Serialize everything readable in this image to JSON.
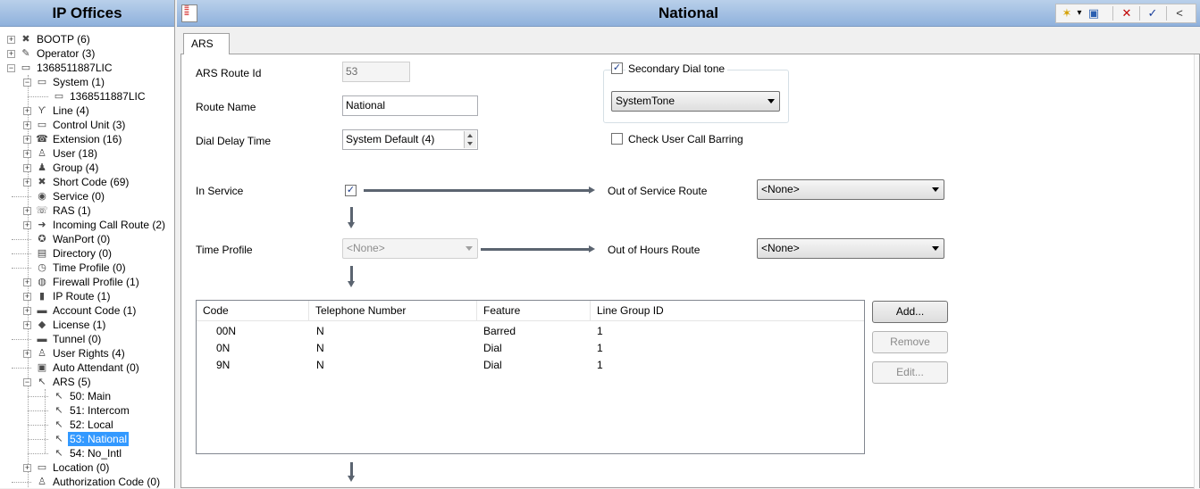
{
  "left_panel": {
    "title": "IP Offices",
    "tree": [
      {
        "label": "BOOTP (6)",
        "icon": "bootp-icon",
        "glyph": "✖"
      },
      {
        "label": "Operator (3)",
        "icon": "operator-icon",
        "glyph": "✎"
      },
      {
        "label": "1368511887LIC",
        "icon": "system-unit-icon",
        "glyph": "▭"
      },
      {
        "label": "System (1)",
        "icon": "system-icon",
        "glyph": "▭"
      },
      {
        "label": "1368511887LIC",
        "icon": "system-unit-icon",
        "glyph": "▭"
      },
      {
        "label": "Line (4)",
        "icon": "line-icon",
        "glyph": "ϒ"
      },
      {
        "label": "Control Unit (3)",
        "icon": "control-unit-icon",
        "glyph": "▭"
      },
      {
        "label": "Extension (16)",
        "icon": "extension-icon",
        "glyph": "☎"
      },
      {
        "label": "User (18)",
        "icon": "user-icon",
        "glyph": "♙"
      },
      {
        "label": "Group (4)",
        "icon": "group-icon",
        "glyph": "♟"
      },
      {
        "label": "Short Code (69)",
        "icon": "short-code-icon",
        "glyph": "✖"
      },
      {
        "label": "Service (0)",
        "icon": "service-icon",
        "glyph": "◉"
      },
      {
        "label": "RAS (1)",
        "icon": "ras-icon",
        "glyph": "☏"
      },
      {
        "label": "Incoming Call Route (2)",
        "icon": "incoming-call-route-icon",
        "glyph": "➜"
      },
      {
        "label": "WanPort (0)",
        "icon": "wanport-icon",
        "glyph": "✪"
      },
      {
        "label": "Directory (0)",
        "icon": "directory-icon",
        "glyph": "▤"
      },
      {
        "label": "Time Profile (0)",
        "icon": "time-profile-icon",
        "glyph": "◷"
      },
      {
        "label": "Firewall Profile (1)",
        "icon": "firewall-profile-icon",
        "glyph": "◍"
      },
      {
        "label": "IP Route (1)",
        "icon": "ip-route-icon",
        "glyph": "▮"
      },
      {
        "label": "Account Code (1)",
        "icon": "account-code-icon",
        "glyph": "▬"
      },
      {
        "label": "License (1)",
        "icon": "license-icon",
        "glyph": "◆"
      },
      {
        "label": "Tunnel (0)",
        "icon": "tunnel-icon",
        "glyph": "▬"
      },
      {
        "label": "User Rights (4)",
        "icon": "user-rights-icon",
        "glyph": "♙"
      },
      {
        "label": "Auto Attendant (0)",
        "icon": "auto-attendant-icon",
        "glyph": "▣"
      },
      {
        "label": "ARS (5)",
        "icon": "ars-icon",
        "glyph": "↖"
      },
      {
        "label": "50: Main",
        "icon": "ars-route-icon",
        "glyph": "↖"
      },
      {
        "label": "51: Intercom",
        "icon": "ars-route-icon",
        "glyph": "↖"
      },
      {
        "label": "52: Local",
        "icon": "ars-route-icon",
        "glyph": "↖"
      },
      {
        "label": "53: National",
        "icon": "ars-route-icon",
        "glyph": "↖"
      },
      {
        "label": "54: No_Intl",
        "icon": "ars-route-icon",
        "glyph": "↖"
      },
      {
        "label": "Location (0)",
        "icon": "location-icon",
        "glyph": "▭"
      },
      {
        "label": "Authorization Code (0)",
        "icon": "authorization-code-icon",
        "glyph": "♙"
      }
    ]
  },
  "main": {
    "title": "National",
    "toolbar": {
      "new_icon": "new-item-icon",
      "export_icon": "export-icon",
      "delete_icon": "delete-icon",
      "ok_icon": "ok-check-icon",
      "back_icon": "back-arrow-icon",
      "new_glyph": "✶",
      "dropdown_glyph": "▾",
      "export_glyph": "▣",
      "delete_glyph": "✕",
      "ok_glyph": "✓",
      "back_glyph": "<"
    },
    "tab": "ARS",
    "form": {
      "route_id_label": "ARS Route Id",
      "route_id_value": "53",
      "route_name_label": "Route Name",
      "route_name_value": "National",
      "dial_delay_label": "Dial Delay Time",
      "dial_delay_value": "System Default (4)",
      "secondary_dial_tone_label": "Secondary Dial tone",
      "secondary_dial_tone_checked": true,
      "secondary_dial_tone_value": "SystemTone",
      "check_user_call_barring_label": "Check User Call Barring",
      "check_user_call_barring_checked": false,
      "in_service_label": "In Service",
      "in_service_checked": true,
      "out_of_service_route_label": "Out of Service Route",
      "out_of_service_route_value": "<None>",
      "time_profile_label": "Time Profile",
      "time_profile_value": "<None>",
      "out_of_hours_route_label": "Out of Hours Route",
      "out_of_hours_route_value": "<None>",
      "check_glyph": "✓"
    },
    "table": {
      "columns": [
        "Code",
        "Telephone Number",
        "Feature",
        "Line Group ID"
      ],
      "rows": [
        [
          "00N",
          "N",
          "Barred",
          "1"
        ],
        [
          "0N",
          "N",
          "Dial",
          "1"
        ],
        [
          "9N",
          "N",
          "Dial",
          "1"
        ]
      ]
    },
    "buttons": {
      "add": "Add...",
      "remove": "Remove",
      "edit": "Edit..."
    }
  }
}
